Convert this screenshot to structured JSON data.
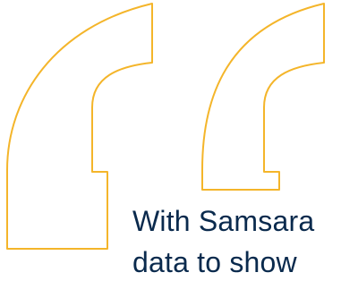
{
  "quote": {
    "line1": "With Samsara",
    "line2": "data to show"
  },
  "colors": {
    "accent": "#F4B52A",
    "text": "#0A2A4D",
    "background": "#FFFFFF"
  },
  "icons": {
    "quote_mark": "open-quote-icon"
  }
}
